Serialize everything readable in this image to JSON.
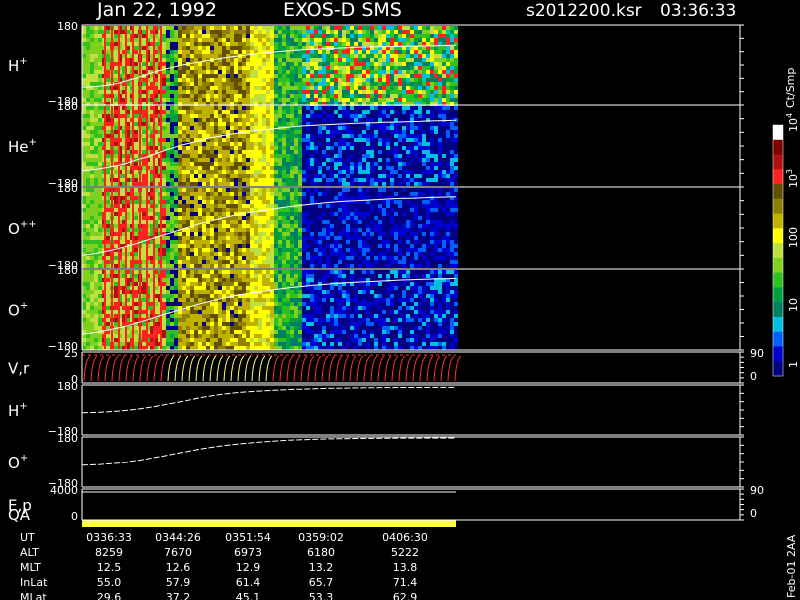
{
  "header": {
    "date": "Jan 22, 1992",
    "instrument": "EXOS-D SMS",
    "file": "s2012200.ksr",
    "time": "03:36:33"
  },
  "colorbar": {
    "unit": "Ct/Smp",
    "ticks": [
      "1",
      "10",
      "100",
      "10",
      "10"
    ],
    "tick_exponents": [
      "",
      "",
      "",
      "3",
      "4"
    ],
    "colors": [
      "#000080",
      "#0000d0",
      "#0060ff",
      "#00c0e0",
      "#008060",
      "#00a040",
      "#30c020",
      "#80d020",
      "#c0e040",
      "#ffff00",
      "#c0b000",
      "#908000",
      "#605000",
      "#ff2020",
      "#b01010",
      "#800000",
      "#ffffff"
    ]
  },
  "chart_data": [
    {
      "type": "heatmap",
      "panel": "H",
      "label": "H",
      "label_sup": "+",
      "ymax": "180",
      "ymin": "−180",
      "pitch_trace": [
        -100,
        -98,
        -95,
        -90,
        -82,
        -70,
        -58,
        -45,
        -30,
        -20,
        -10,
        0,
        8,
        15,
        22,
        28,
        35,
        40,
        45,
        50,
        55,
        58,
        62,
        65,
        68,
        70,
        72,
        74,
        76,
        78,
        80,
        81,
        82,
        82,
        83,
        84,
        85,
        85,
        86,
        87,
        88,
        89
      ]
    },
    {
      "type": "heatmap",
      "panel": "He",
      "label": "He",
      "label_sup": "+",
      "ymax": "180",
      "ymin": "−180",
      "pitch_trace": [
        -110,
        -105,
        -100,
        -92,
        -85,
        -75,
        -60,
        -50,
        -35,
        -20,
        -8,
        5,
        15,
        25,
        35,
        42,
        50,
        56,
        62,
        68,
        72,
        76,
        80,
        84,
        88,
        90,
        92,
        94,
        96,
        98,
        100,
        101,
        102,
        104,
        105,
        106,
        107,
        108,
        110,
        111,
        112,
        113
      ]
    },
    {
      "type": "heatmap",
      "panel": "O++",
      "label": "O",
      "label_sup": "++",
      "ymax": "180",
      "ymin": "−180",
      "pitch_trace": [
        -120,
        -115,
        -108,
        -100,
        -90,
        -80,
        -68,
        -55,
        -42,
        -30,
        -18,
        -5,
        8,
        20,
        30,
        40,
        50,
        58,
        66,
        72,
        78,
        84,
        90,
        95,
        100,
        104,
        108,
        112,
        115,
        118,
        120,
        122,
        124,
        126,
        128,
        130,
        131,
        132,
        134,
        135,
        136,
        137
      ]
    },
    {
      "type": "heatmap",
      "panel": "O+",
      "label": "O",
      "label_sup": "+",
      "ymax": "180",
      "ymin": "−180",
      "pitch_trace": [
        -110,
        -105,
        -98,
        -90,
        -82,
        -72,
        -60,
        -48,
        -35,
        -22,
        -10,
        2,
        14,
        26,
        36,
        46,
        55,
        63,
        70,
        76,
        82,
        88,
        93,
        98,
        102,
        106,
        110,
        113,
        116,
        119,
        121,
        123,
        125,
        127,
        129,
        131,
        132,
        134,
        135,
        136,
        137,
        138
      ]
    },
    {
      "type": "line",
      "panel": "Vr",
      "label": "V,r",
      "ymax": "25",
      "ymin": "0",
      "right_top": "90",
      "right_bottom": "0"
    },
    {
      "type": "line",
      "panel": "H-pitch",
      "label": "H",
      "label_sup": "+",
      "ymax": "180",
      "ymin": "−180",
      "trace": [
        -20,
        -18,
        -16,
        -12,
        -8,
        -2,
        5,
        15,
        25,
        38,
        50,
        62,
        75,
        90,
        100,
        110,
        118,
        125,
        130,
        135,
        138,
        142,
        145,
        148,
        150,
        152,
        154,
        156,
        157,
        158,
        159,
        160,
        160,
        161,
        161,
        162,
        162,
        162,
        163,
        163,
        163,
        163
      ]
    },
    {
      "type": "line",
      "panel": "O-pitch",
      "label": "O",
      "label_sup": "+",
      "ymax": "180",
      "ymin": "−180",
      "trace": [
        -20,
        -18,
        -15,
        -10,
        -5,
        0,
        8,
        18,
        30,
        42,
        55,
        68,
        80,
        92,
        102,
        112,
        120,
        128,
        134,
        140,
        145,
        150,
        154,
        158,
        160,
        162,
        164,
        166,
        167,
        168,
        169,
        170,
        170,
        171,
        171,
        172,
        172,
        172,
        173,
        173,
        173,
        173
      ]
    },
    {
      "type": "line",
      "panel": "Ep",
      "label": "E,p",
      "ymax": "4000",
      "ymin": "0",
      "right_top": "90",
      "right_bottom": "0"
    },
    {
      "type": "bar",
      "panel": "QA",
      "label": "QA"
    }
  ],
  "ephemeris": {
    "rows": [
      {
        "label": "UT",
        "values": [
          "0336:33",
          "0344:26",
          "0351:54",
          "0359:02",
          "0406:30"
        ]
      },
      {
        "label": "ALT",
        "values": [
          "8259",
          "7670",
          "6973",
          "6180",
          "5222"
        ]
      },
      {
        "label": "MLT",
        "values": [
          "12.5",
          "12.6",
          "12.9",
          "13.2",
          "13.8"
        ]
      },
      {
        "label": "InLat",
        "values": [
          "55.0",
          "57.9",
          "61.4",
          "65.7",
          "71.4"
        ]
      },
      {
        "label": "MLat",
        "values": [
          "29.6",
          "37.2",
          "45.1",
          "53.3",
          "62.9"
        ]
      }
    ]
  },
  "footer": {
    "stamp": "Feb-01 2AA"
  }
}
